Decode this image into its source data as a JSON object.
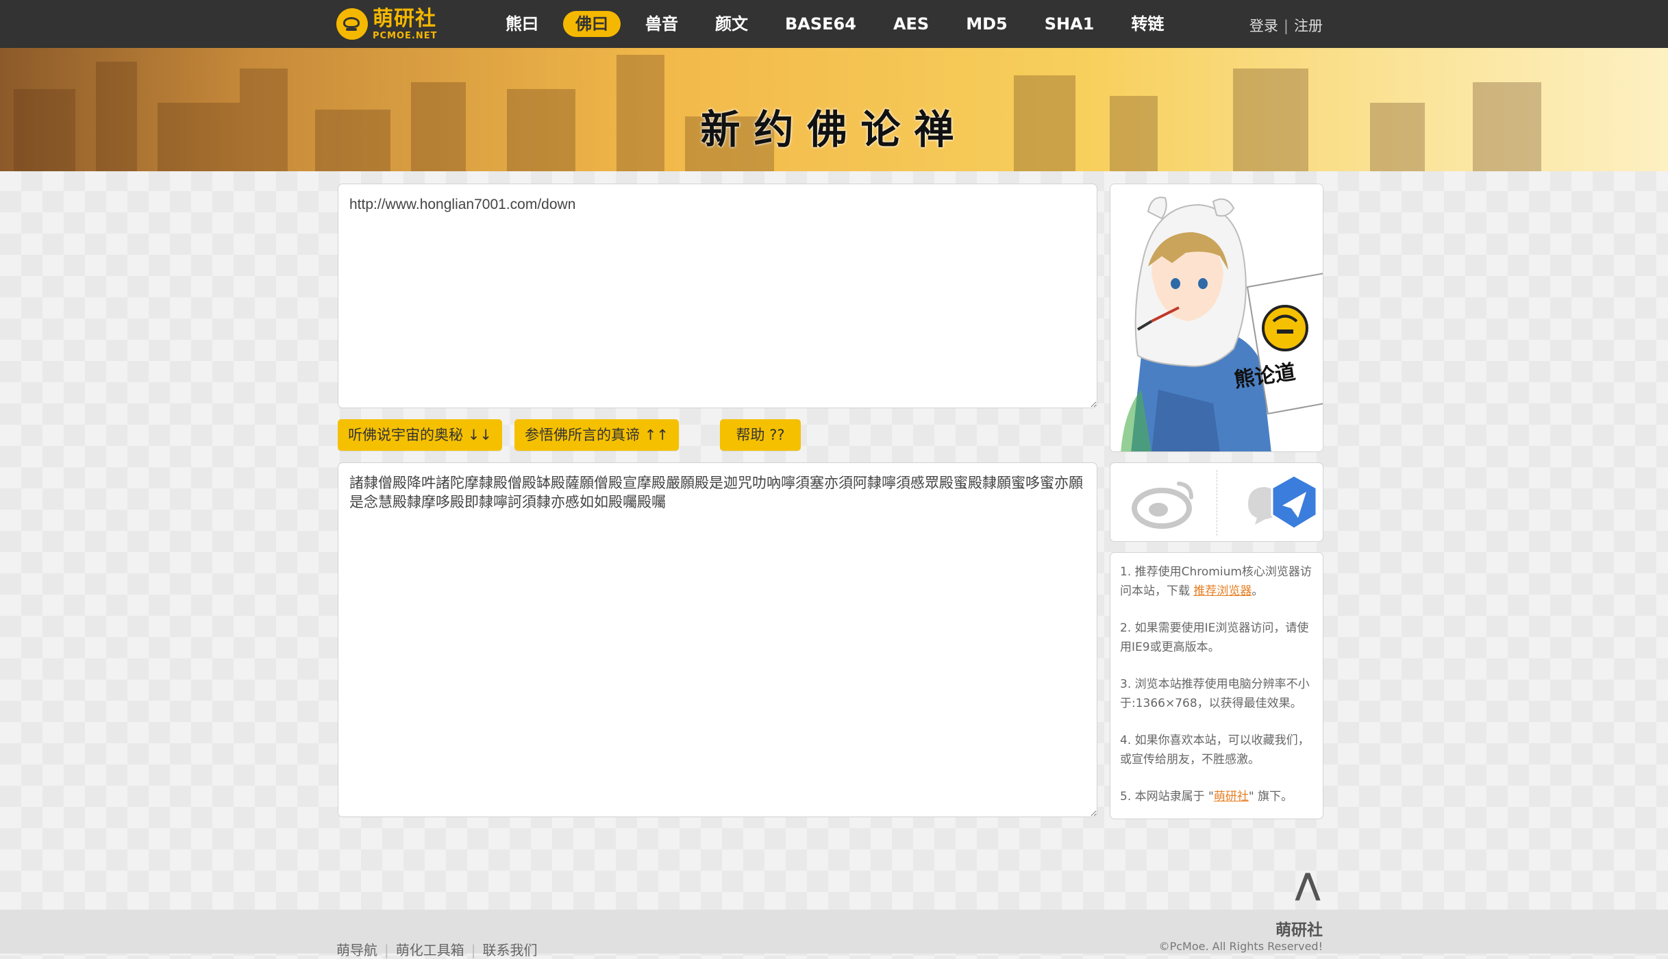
{
  "header": {
    "logo_title": "萌研社",
    "logo_sub": "PCMOE.NET",
    "nav": [
      {
        "label": "熊曰",
        "active": false
      },
      {
        "label": "佛曰",
        "active": true
      },
      {
        "label": "兽音",
        "active": false
      },
      {
        "label": "颜文",
        "active": false
      },
      {
        "label": "BASE64",
        "active": false
      },
      {
        "label": "AES",
        "active": false
      },
      {
        "label": "MD5",
        "active": false
      },
      {
        "label": "SHA1",
        "active": false
      },
      {
        "label": "转链",
        "active": false
      }
    ],
    "login": "登录",
    "separator": "|",
    "register": "注册"
  },
  "banner": {
    "title": "新约佛论禅"
  },
  "main": {
    "input_text": "http://www.honglian7001.com/down",
    "output_text": "諸隸僧殿降吽諸陀摩隸殿僧殿缽殿薩願僧殿宣摩殿嚴願殿是迦咒叻吶嚀須塞亦須阿隸嚀須慼眾殿蜜殿隸願蜜哆蜜亦願是念慧殿隸摩哆殿即隸嚀訶須隸亦慼如如殿囑殿囑",
    "buttons": {
      "encode": "听佛说宇宙的奥秘 ↓↓",
      "decode": "参悟佛所言的真谛 ↑↑",
      "help": "帮助 ??"
    }
  },
  "sidebar": {
    "mascot_sign": "熊论道",
    "notes": [
      {
        "text": "1. 推荐使用Chromium核心浏览器访问本站，下载 ",
        "link": "推荐浏览器",
        "after": "。"
      },
      {
        "text": "2. 如果需要使用IE浏览器访问，请使用IE9或更高版本。",
        "link": "",
        "after": ""
      },
      {
        "text": "3. 浏览本站推荐使用电脑分辨率不小于:1366×768，以获得最佳效果。",
        "link": "",
        "after": ""
      },
      {
        "text": "4. 如果你喜欢本站，可以收藏我们，或宣传给朋友，不胜感激。",
        "link": "",
        "after": ""
      },
      {
        "text": "5. 本网站隶属于 \"",
        "link": "萌研社",
        "after": "\" 旗下。"
      }
    ]
  },
  "footer": {
    "links": [
      "萌导航",
      "萌化工具箱",
      "联系我们"
    ],
    "brand": "萌研社",
    "copyright": "©PcMoe. All Rights Reserved!"
  },
  "to_top": "⋀",
  "colors": {
    "accent": "#f5c000",
    "topbar": "#333333",
    "link": "#e67e22"
  }
}
